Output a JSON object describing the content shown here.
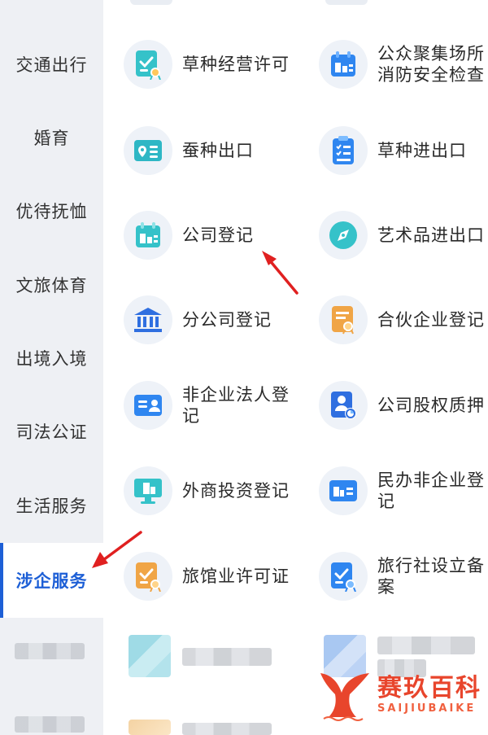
{
  "sidebar": {
    "items": [
      {
        "label": "交通出行"
      },
      {
        "label": "婚育"
      },
      {
        "label": "优待抚恤"
      },
      {
        "label": "文旅体育"
      },
      {
        "label": "出境入境"
      },
      {
        "label": "司法公证"
      },
      {
        "label": "生活服务"
      },
      {
        "label": "涉企服务"
      }
    ],
    "active_index": 7
  },
  "services": [
    {
      "label": "草种经营许可",
      "icon": "certificate-check-icon"
    },
    {
      "label": "公众聚集场所消防安全检查",
      "icon": "building-calendar-icon"
    },
    {
      "label": "蚕种出口",
      "icon": "location-id-card-icon"
    },
    {
      "label": "草种进出口",
      "icon": "checklist-clipboard-icon"
    },
    {
      "label": "公司登记",
      "icon": "building-calendar-icon"
    },
    {
      "label": "艺术品进出口",
      "icon": "compass-icon"
    },
    {
      "label": "分公司登记",
      "icon": "bank-building-icon"
    },
    {
      "label": "合伙企业登记",
      "icon": "certificate-document-icon"
    },
    {
      "label": "非企业法人登记",
      "icon": "id-card-icon"
    },
    {
      "label": "公司股权质押",
      "icon": "person-pie-chart-icon"
    },
    {
      "label": "外商投资登记",
      "icon": "monitor-building-icon"
    },
    {
      "label": "民办非企业登记",
      "icon": "building-card-icon"
    },
    {
      "label": "旅馆业许可证",
      "icon": "certificate-check-icon"
    },
    {
      "label": "旅行社设立备案",
      "icon": "certificate-check-icon"
    }
  ],
  "watermark": {
    "name_cn": "赛玖百科",
    "name_en": "SAIJIUBAIKE"
  },
  "colors": {
    "accent": "#1d5fd6",
    "arrow": "#e02020",
    "watermark": "#e8452c"
  }
}
